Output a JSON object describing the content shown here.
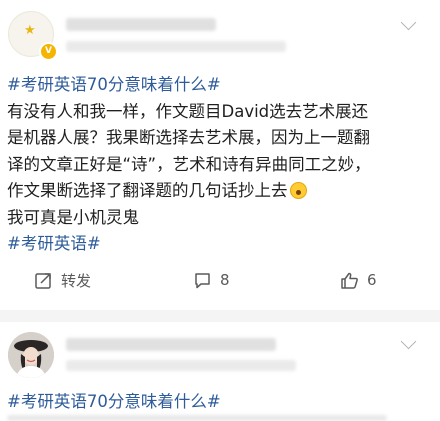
{
  "post1": {
    "topic": "#考研英语70分意味着什么#",
    "lines": [
      "有没有人和我一样，作文题目David选去艺术展还",
      "是机器人展？我果断选择去艺术展，因为上一题翻",
      "译的文章正好是“诗”，艺术和诗有异曲同工之妙，",
      "作文果断选择了翻译题的几句话抄上去"
    ],
    "last_line": "我可真是小机灵鬼",
    "tag": "#考研英语#",
    "emoji": "scream-emoji",
    "actions": {
      "repost_label": "转发",
      "comment_count": "8",
      "like_count": "6"
    }
  },
  "post2": {
    "topic": "#考研英语70分意味着什么#"
  },
  "icons": {
    "avatar_badge": "verified-v-badge",
    "more": "chevron-down-icon",
    "repost": "repost-icon",
    "comment": "comment-icon",
    "like": "thumbs-up-icon"
  },
  "colors": {
    "topic_link": "#2e5b9a",
    "text": "#1f1f1f",
    "action_text": "#5a5a5a",
    "verified_badge": "#f5b400"
  }
}
